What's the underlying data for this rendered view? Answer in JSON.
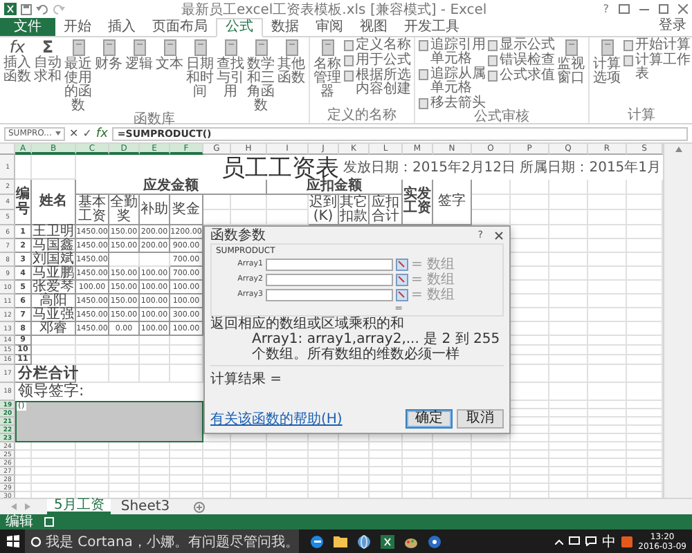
{
  "title_bar": {
    "title": "最新员工excel工资表模板.xls [兼容模式] - Excel",
    "help": "?"
  },
  "ribbon_tabs": [
    {
      "label": "文件",
      "selected": false,
      "kind": "file"
    },
    {
      "label": "开始",
      "selected": false,
      "kind": "tab"
    },
    {
      "label": "插入",
      "selected": false,
      "kind": "tab"
    },
    {
      "label": "页面布局",
      "selected": false,
      "kind": "tab"
    },
    {
      "label": "公式",
      "selected": true,
      "kind": "tab"
    },
    {
      "label": "数据",
      "selected": false,
      "kind": "tab"
    },
    {
      "label": "审阅",
      "selected": false,
      "kind": "tab"
    },
    {
      "label": "视图",
      "selected": false,
      "kind": "tab"
    },
    {
      "label": "开发工具",
      "selected": false,
      "kind": "tab"
    }
  ],
  "account": "登录",
  "ribbon": {
    "groups": [
      {
        "label": "函数库",
        "items": [
          {
            "kind": "large",
            "label": "插入函数",
            "glyph": "fx"
          },
          {
            "kind": "large",
            "label": "自动求和",
            "glyph": "Σ"
          },
          {
            "kind": "large",
            "label": "最近使用的函数"
          },
          {
            "kind": "large",
            "label": "财务"
          },
          {
            "kind": "large",
            "label": "逻辑"
          },
          {
            "kind": "large",
            "label": "文本"
          },
          {
            "kind": "large",
            "label": "日期和时间"
          },
          {
            "kind": "large",
            "label": "查找与引用"
          },
          {
            "kind": "large",
            "label": "数学和三角函数"
          },
          {
            "kind": "large",
            "label": "其他函数"
          }
        ]
      },
      {
        "label": "定义的名称",
        "items": [
          {
            "kind": "large",
            "label": "名称管理器"
          },
          {
            "kind": "stack",
            "entries": [
              "定义名称",
              "用于公式",
              "根据所选内容创建"
            ]
          }
        ]
      },
      {
        "label": "公式审核",
        "items": [
          {
            "kind": "stack",
            "entries": [
              "追踪引用单元格",
              "追踪从属单元格",
              "移去箭头"
            ]
          },
          {
            "kind": "stack",
            "entries": [
              "显示公式",
              "错误检查",
              "公式求值"
            ]
          },
          {
            "kind": "large",
            "label": "监视窗口"
          }
        ]
      },
      {
        "label": "计算",
        "items": [
          {
            "kind": "large",
            "label": "计算选项"
          },
          {
            "kind": "stack",
            "entries": [
              "开始计算",
              "计算工作表"
            ]
          }
        ]
      }
    ]
  },
  "formula_bar": {
    "name_box": "SUMPRO...",
    "cancel": "✕",
    "enter": "✓",
    "fx": "fx",
    "formula": "=SUMPRODUCT()"
  },
  "sheet": {
    "columns": [
      {
        "label": "A",
        "selected": true
      },
      {
        "label": "B",
        "selected": true
      },
      {
        "label": "C",
        "selected": true
      },
      {
        "label": "D",
        "selected": true
      },
      {
        "label": "E",
        "selected": true
      },
      {
        "label": "F",
        "selected": true
      },
      {
        "label": "G",
        "selected": false
      },
      {
        "label": "H",
        "selected": false
      },
      {
        "label": "I",
        "selected": false
      },
      {
        "label": "J",
        "selected": false
      },
      {
        "label": "K",
        "selected": false
      },
      {
        "label": "L",
        "selected": false
      },
      {
        "label": "M",
        "selected": false
      },
      {
        "label": "N",
        "selected": false
      },
      {
        "label": "O",
        "selected": false
      },
      {
        "label": "P",
        "selected": false
      },
      {
        "label": "Q",
        "selected": false
      },
      {
        "label": "R",
        "selected": false
      },
      {
        "label": "S",
        "selected": false
      }
    ],
    "row_headers": [
      {
        "label": "1",
        "selected": false
      },
      {
        "label": "2",
        "selected": false
      },
      {
        "label": "4",
        "selected": false
      },
      {
        "label": "5",
        "selected": false
      },
      {
        "label": "6",
        "selected": false
      },
      {
        "label": "7",
        "selected": false
      },
      {
        "label": "8",
        "selected": false
      },
      {
        "label": "9",
        "selected": false
      },
      {
        "label": "10",
        "selected": false
      },
      {
        "label": "11",
        "selected": false
      },
      {
        "label": "12",
        "selected": false
      },
      {
        "label": "13",
        "selected": false
      },
      {
        "label": "14",
        "selected": false
      },
      {
        "label": "15",
        "selected": false
      },
      {
        "label": "16",
        "selected": false
      },
      {
        "label": "17",
        "selected": false
      },
      {
        "label": "18",
        "selected": false
      },
      {
        "label": "19",
        "selected": true
      },
      {
        "label": "20",
        "selected": true
      },
      {
        "label": "21",
        "selected": true
      },
      {
        "label": "22",
        "selected": true
      },
      {
        "label": "23",
        "selected": true
      },
      {
        "label": "24",
        "selected": false
      },
      {
        "label": "25",
        "selected": false
      },
      {
        "label": "26",
        "selected": false
      },
      {
        "label": "27",
        "selected": false
      },
      {
        "label": "28",
        "selected": false
      },
      {
        "label": "29",
        "selected": false
      },
      {
        "label": "30",
        "selected": false
      }
    ],
    "title": "员工工资表",
    "dates": "发放日期：2015年2月12日 所属日期：2015年1月",
    "number_header": "编号",
    "name_header": "姓名",
    "pay_group": "应发金额",
    "deduction_group": "应扣金额",
    "pay_subheaders": [
      "基本工资",
      "全勤奖",
      "补助",
      "奖金"
    ],
    "deduction_subheaders": [
      "迟到(K)",
      "其它扣款",
      "应扣合计"
    ],
    "net_pay_header": "实发工资",
    "signature_header": "签字",
    "rows": [
      {
        "no": "1",
        "name": "王卫明",
        "cells": [
          "1450.00",
          "150.00",
          "200.00",
          "1200.00"
        ]
      },
      {
        "no": "2",
        "name": "马国鑫",
        "cells": [
          "1450.00",
          "150.00",
          "200.00",
          "900.00"
        ]
      },
      {
        "no": "3",
        "name": "刘国斌",
        "cells": [
          "1450.00",
          "",
          "",
          "700.00"
        ]
      },
      {
        "no": "4",
        "name": "马亚鹏",
        "cells": [
          "1450.00",
          "150.00",
          "100.00",
          "700.00"
        ]
      },
      {
        "no": "5",
        "name": "张爱琴",
        "cells": [
          "100.00",
          "150.00",
          "100.00",
          "100.00"
        ]
      },
      {
        "no": "6",
        "name": "高阳",
        "cells": [
          "1450.00",
          "150.00",
          "100.00",
          "100.00"
        ]
      },
      {
        "no": "7",
        "name": "马亚强",
        "cells": [
          "1450.00",
          "150.00",
          "100.00",
          "300.00"
        ]
      },
      {
        "no": "8",
        "name": "邓睿",
        "cells": [
          "1450.00",
          "0.00",
          "100.00",
          "100.00"
        ]
      },
      {
        "no": "9"
      },
      {
        "no": "10"
      },
      {
        "no": "11"
      }
    ],
    "subtotal": "分栏合计",
    "leader_signature": "领导签字:",
    "active_cell": "()"
  },
  "dialog": {
    "title": "函数参数",
    "help": "?",
    "function": "SUMPRODUCT",
    "arguments": [
      {
        "label": "Array1",
        "result": "= 数组"
      },
      {
        "label": "Array2",
        "result": "= 数组"
      },
      {
        "label": "Array3",
        "result": "= 数组"
      }
    ],
    "equals": "=",
    "description": "返回相应的数组或区域乘积的和",
    "argument_help": "Array1:  array1,array2,... 是 2 到 255 个数组。所有数组的维数必须一样",
    "result_label": "计算结果 =",
    "help_link": "有关该函数的帮助(H)",
    "buttons": [
      {
        "label": "确定",
        "kind": "primary"
      },
      {
        "label": "取消",
        "kind": "normal"
      }
    ]
  },
  "sheet_tabs": [
    {
      "label": "5月工资",
      "selected": true
    },
    {
      "label": "Sheet3",
      "selected": false
    }
  ],
  "status_bar": {
    "mode": "编辑"
  },
  "taskbar": {
    "search": "我是 Cortana，小娜。有问题尽管问我。",
    "ime": "中",
    "time": "13:20",
    "date": "2016-03-09"
  }
}
